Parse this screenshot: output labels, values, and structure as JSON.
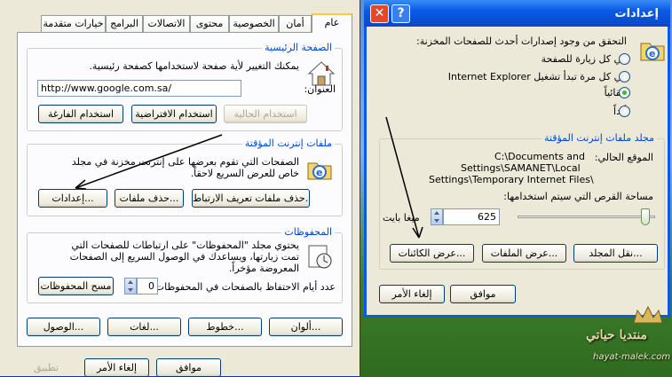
{
  "internet_options": {
    "tabs": [
      "عام",
      "أمان",
      "الخصوصية",
      "محتوى",
      "الاتصالات",
      "البرامج",
      "خيارات متقدمة"
    ],
    "home_page": {
      "group_title": "الصفحة الرئيسية",
      "description": "يمكنك التغيير لأية صفحة لاستخدامها كصفحة رئيسية.",
      "address_label": "العنوان:",
      "address_value": "http://www.google.com.sa/",
      "use_current": "استخدام الحالية",
      "use_default": "استخدام الافتراضية",
      "use_blank": "استخدام الفارغة"
    },
    "temp_files": {
      "group_title": "ملفات إنترنت المؤقتة",
      "description": "الصفحات التي تقوم بعرضها على إنترنت مخزنة في مجلد خاص للعرض السريع لاحقاً.",
      "delete_cookies": "حذف ملفات تعريف الارتباط...",
      "delete_files": "حذف ملفات...",
      "settings": "إعدادات..."
    },
    "history": {
      "group_title": "المحفوظات",
      "description": "يحتوي مجلد \"المحفوظات\" على ارتباطات للصفحات التي تمت زيارتها، ويساعدك في الوصول السريع إلى الصفحات المعروضة مؤخراً.",
      "days_label": "عدد أيام الاحتفاظ بالصفحات في المحفوظات:",
      "days_value": "0",
      "clear": "مسح المحفوظات"
    },
    "bottom_buttons": {
      "colors": "ألوان...",
      "fonts": "خطوط...",
      "languages": "لغات...",
      "accessibility": "الوصول..."
    },
    "footer": {
      "ok": "موافق",
      "cancel": "إلغاء الأمر",
      "apply": "تطبيق"
    }
  },
  "settings_dialog": {
    "title": "إعدادات",
    "check_label": "التحقق من وجود إصدارات أحدث للصفحات المخزنة:",
    "options": [
      "في كل زيارة للصفحة",
      "في كل مرة تبدأ تشغيل Internet Explorer",
      "تلقائياً",
      "أبداً"
    ],
    "selected_option": "تلقائياً",
    "temp_folder": {
      "group_title": "مجلد ملفات إنترنت المؤقتة",
      "current_location_label": "الموقع الحالي:",
      "path_line1": "C:\\Documents and",
      "path_line2": "Settings\\SAMANET\\Local",
      "path_line3": "Settings\\Temporary Internet Files\\",
      "disk_space_label": "مساحة القرص التي سيتم استخدامها:",
      "disk_value": "625",
      "disk_unit": "ميغا بايت",
      "slider_level": 0.96,
      "move_folder": "نقل المجلد...",
      "view_files": "عرض الملفات...",
      "view_objects": "عرض الكائنات..."
    },
    "ok": "موافق",
    "cancel": "إلغاء الأمر"
  },
  "watermark": {
    "text1": "منتديا حياتي",
    "text2": "hayat-malek.com"
  },
  "colors": {
    "title_bar": "#0a5ae6",
    "accent_blue": "#0046d5",
    "close_red": "#e04a2a"
  }
}
